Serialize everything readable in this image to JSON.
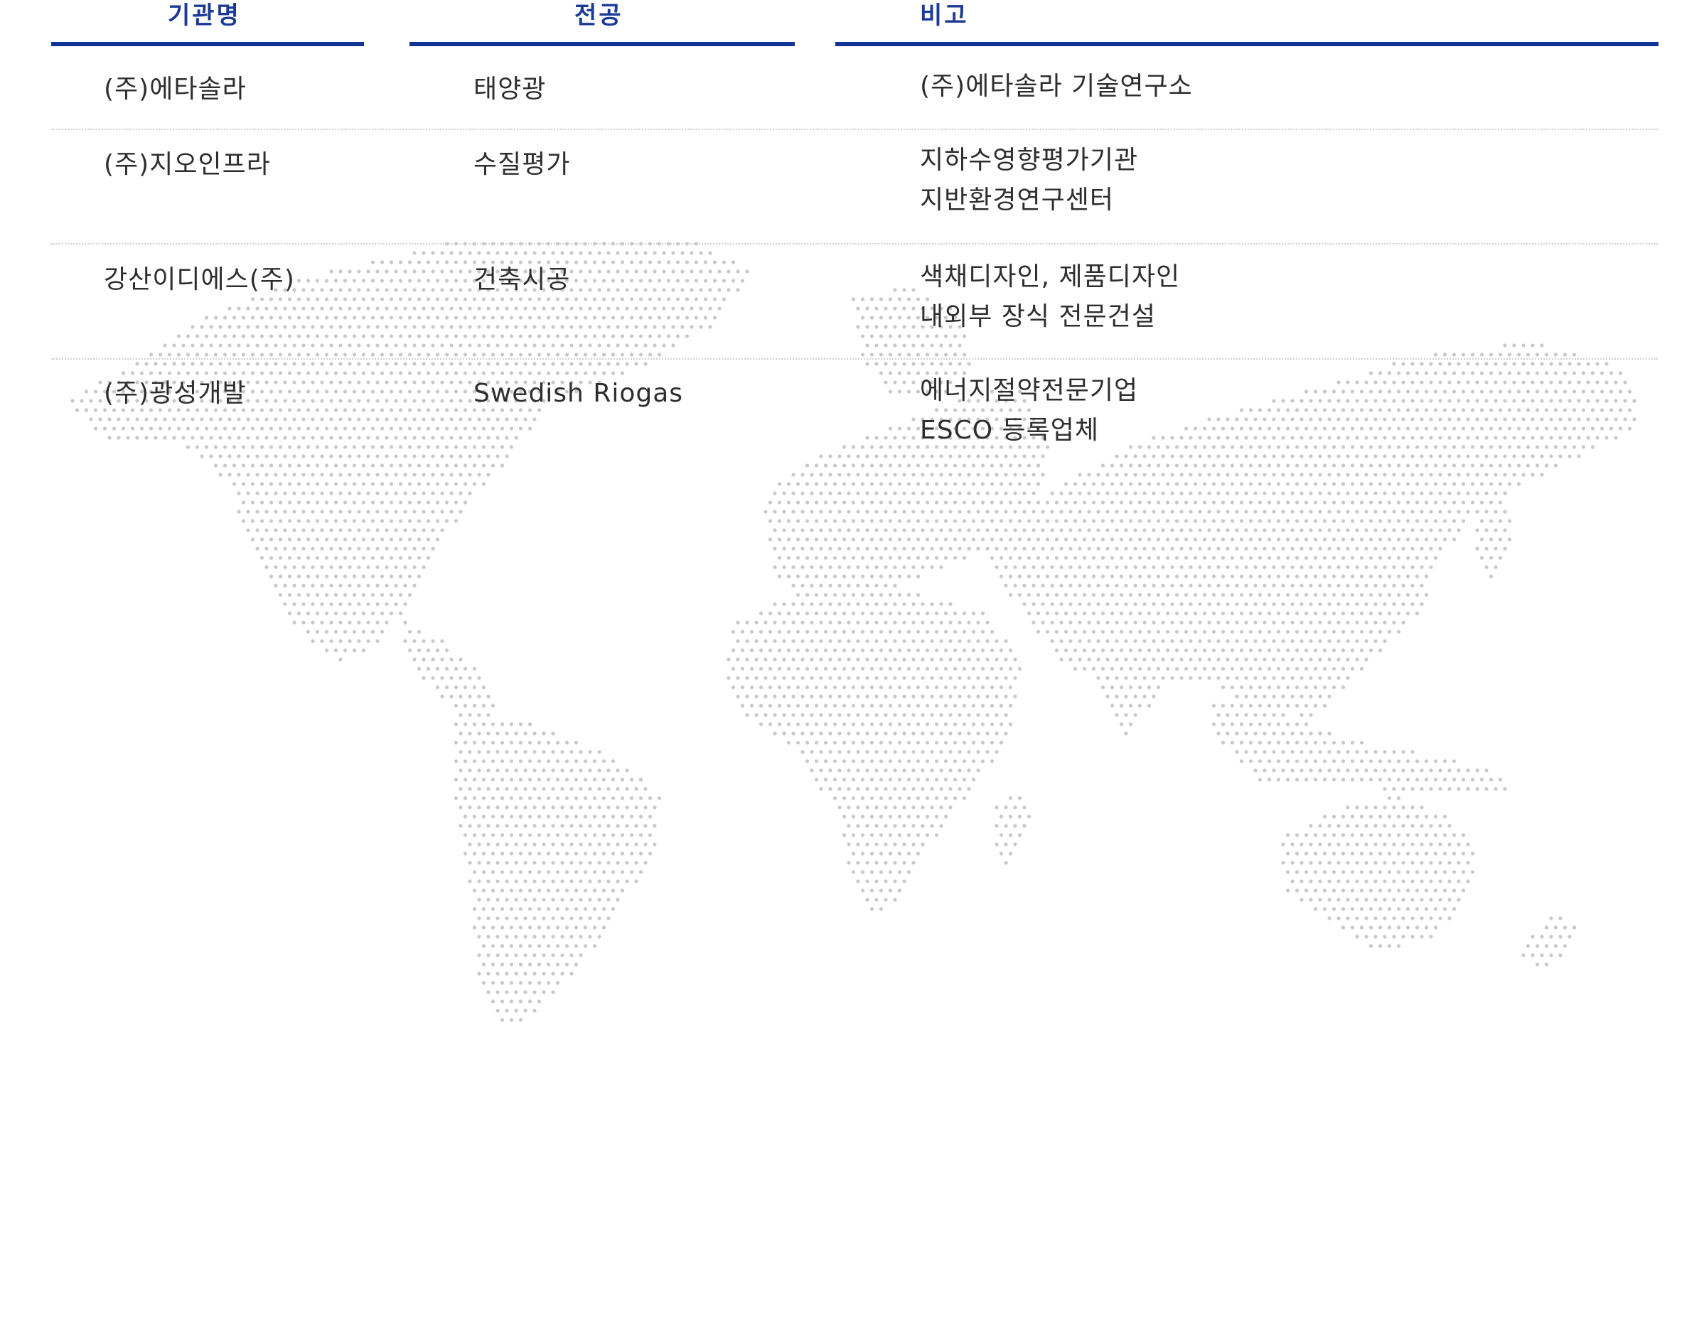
{
  "table": {
    "headers": {
      "org": "기관명",
      "major": "전공",
      "note": "비고"
    },
    "rows": [
      {
        "org": "(주)에타솔라",
        "major": "태양광",
        "note": [
          "(주)에타솔라 기술연구소"
        ]
      },
      {
        "org": "(주)지오인프라",
        "major": "수질평가",
        "note": [
          "지하수영향평가기관",
          "지반환경연구센터"
        ]
      },
      {
        "org": "강산이디에스(주)",
        "major": "건축시공",
        "note": [
          "색채디자인, 제품디자인",
          "내외부 장식 전문건설"
        ]
      },
      {
        "org": "(주)광성개발",
        "major": "Swedish Riogas",
        "note": [
          "에너지절약전문기업",
          "ESCO 등록업체"
        ]
      }
    ]
  },
  "colors": {
    "header_text": "#1a3a96",
    "header_rule": "#0f3496",
    "divider": "#cfcfcf",
    "map_dots": "#c9c9c9"
  },
  "background": {
    "icon": "world-map-dot-icon"
  }
}
